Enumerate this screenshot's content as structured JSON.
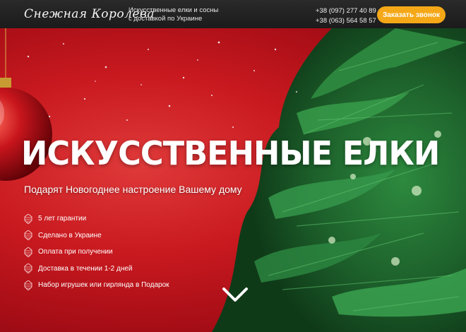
{
  "header": {
    "logo": "Снежная Королева",
    "tagline_line1": "Искусственные елки и сосны",
    "tagline_line2": "с доставкой по Украине",
    "phone1": "+38 (097) 277 40 89",
    "phone2": "+38 (063) 564 58 57",
    "call_button": "Заказать звонок"
  },
  "hero": {
    "title": "ИСКУССТВЕННЫЕ ЕЛКИ",
    "subtitle": "Подарят Новогоднее настроение Вашему дому",
    "features": [
      {
        "icon": "pinecone-icon",
        "label": "5 лет гарантии"
      },
      {
        "icon": "pinecone-icon",
        "label": "Сделано в Украине"
      },
      {
        "icon": "pinecone-icon",
        "label": "Оплата при получении"
      },
      {
        "icon": "pinecone-icon",
        "label": "Доставка в течении 1-2 дней"
      },
      {
        "icon": "pinecone-icon",
        "label": "Набор игрушек или гирлянда в Подарок"
      }
    ],
    "scroll_icon": "chevron-down-icon"
  },
  "colors": {
    "header_bg": "#1f1f1f",
    "accent_button": "#f5a817",
    "hero_red": "#c8191f",
    "tree_green": "#1f6b2e"
  }
}
